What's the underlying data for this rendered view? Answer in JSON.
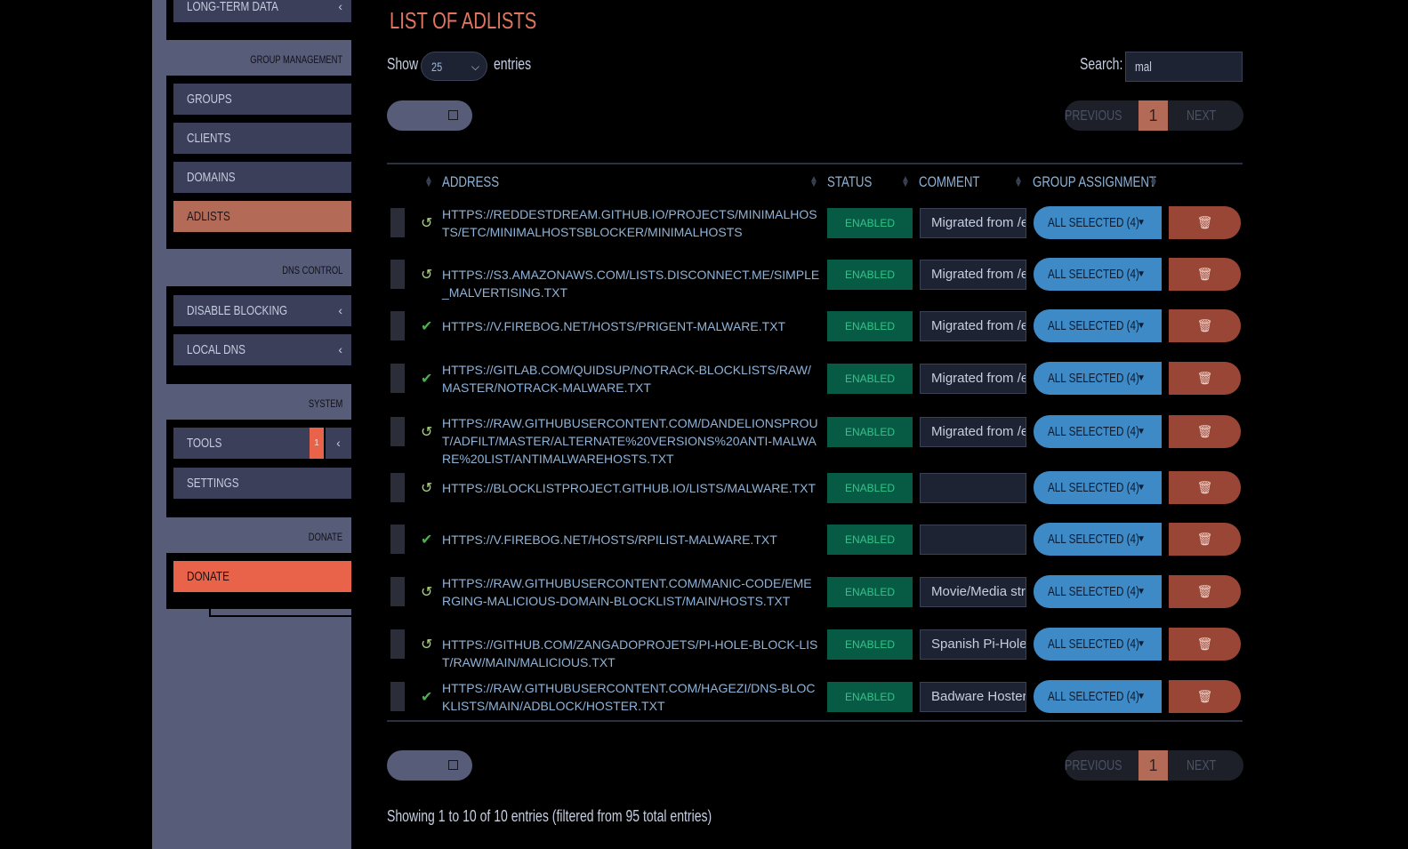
{
  "sidebar": {
    "top_item": {
      "label": "Long-term Data"
    },
    "sections": [
      {
        "header": "Group Management",
        "items": [
          {
            "label": "Groups"
          },
          {
            "label": "Clients"
          },
          {
            "label": "Domains"
          },
          {
            "label": "Adlists",
            "active": true
          }
        ]
      },
      {
        "header": "DNS Control",
        "items": [
          {
            "label": "Disable Blocking"
          },
          {
            "label": "Local DNS"
          }
        ]
      },
      {
        "header": "System",
        "items": [
          {
            "label": "Tools",
            "badge": "1"
          },
          {
            "label": "Settings"
          }
        ]
      },
      {
        "header": "Donate",
        "items": [
          {
            "label": "Donate"
          }
        ]
      }
    ]
  },
  "main": {
    "title": "LIST OF ADLISTS",
    "show_label": "Show",
    "page_size": "25",
    "entries_label": "entries",
    "search_label": "Search:",
    "search_value": "mal",
    "pagination": {
      "previous": "PREVIOUS",
      "current": "1",
      "next": "NEXT"
    },
    "columns": {
      "address": "ADDRESS",
      "status": "STATUS",
      "comment": "COMMENT",
      "group": "GROUP ASSIGNMENT"
    },
    "rows": [
      {
        "icon": "history-icon",
        "address": "https://reddestdream.github.io/Projects/MinimalHosts/etc/MinimalHostsBlocker/minimalhosts",
        "status": "ENABLED",
        "comment": "Migrated from /etc",
        "group": "ALL SELECTED (4)"
      },
      {
        "icon": "history-icon",
        "address": "https://s3.amazonaws.com/lists.disconnect.me/simple_malvertising.txt",
        "status": "ENABLED",
        "comment": "Migrated from /etc",
        "group": "ALL SELECTED (4)"
      },
      {
        "icon": "check-icon",
        "address": "https://v.firebog.net/hosts/Prigent-Malware.txt",
        "status": "ENABLED",
        "comment": "Migrated from /etc",
        "group": "ALL SELECTED (4)"
      },
      {
        "icon": "check-icon",
        "address": "https://gitlab.com/quidsup/notrack-blocklists/raw/master/notrack-malware.txt",
        "status": "ENABLED",
        "comment": "Migrated from /etc",
        "group": "ALL SELECTED (4)"
      },
      {
        "icon": "history-icon",
        "address": "https://raw.githubusercontent.com/DandelionSprout/adfilt/master/Alternate%20versions%20Anti-Malware%20List/AntiMalwareHosts.txt",
        "status": "ENABLED",
        "comment": "Migrated from /etc",
        "group": "ALL SELECTED (4)"
      },
      {
        "icon": "history-icon",
        "address": "https://blocklistproject.github.io/Lists/malware.txt",
        "status": "ENABLED",
        "comment": "",
        "group": "ALL SELECTED (4)"
      },
      {
        "icon": "check-icon",
        "address": "https://v.firebog.net/hosts/RPiList-Malware.txt",
        "status": "ENABLED",
        "comment": "",
        "group": "ALL SELECTED (4)"
      },
      {
        "icon": "history-icon",
        "address": "https://raw.githubusercontent.com/Manic-code/emerging-malicious-domain-blocklist/main/hosts.txt",
        "status": "ENABLED",
        "comment": "Movie/Media streaming",
        "group": "ALL SELECTED (4)"
      },
      {
        "icon": "history-icon",
        "address": "https://github.com/zangadoprojets/pi-hole-block-list/raw/main/Malicious.txt",
        "status": "ENABLED",
        "comment": "Spanish Pi-Hole Bl",
        "group": "ALL SELECTED (4)"
      },
      {
        "icon": "check-icon",
        "address": "https://raw.githubusercontent.com/hagezi/dns-blocklists/main/adblock/hoster.txt",
        "status": "ENABLED",
        "comment": "Badware Hoster bl",
        "group": "ALL SELECTED (4)"
      }
    ],
    "info": "Showing 1 to 10 of 10 entries (filtered from 95 total entries)"
  },
  "colors": {
    "accent": "#e8634a",
    "status_bg": "#075a44",
    "group_btn": "#3d8ac6",
    "delete_btn": "#9a4636",
    "link": "#8fb3d8"
  }
}
